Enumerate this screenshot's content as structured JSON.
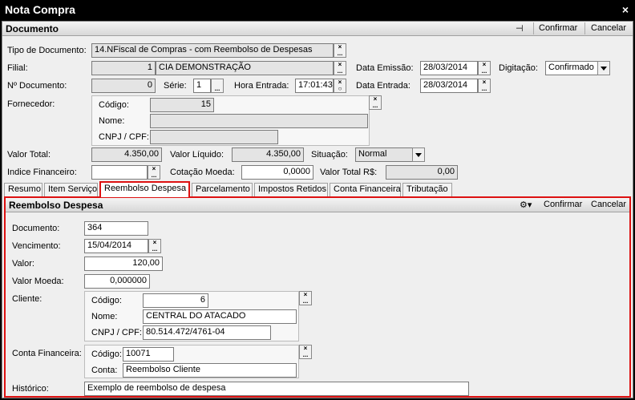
{
  "window": {
    "title": "Nota Compra",
    "close_icon": "×"
  },
  "header": {
    "label": "Documento",
    "pin_icon": "⊣",
    "confirm": "Confirmar",
    "cancel": "Cancelar"
  },
  "form": {
    "tipo_doc_label": "Tipo de Documento:",
    "tipo_doc_value": "14.NFiscal de Compras - com Reembolso de Despesas",
    "filial_label": "Filial:",
    "filial_code": "1",
    "filial_name": "CIA DEMONSTRAÇÃO",
    "data_emissao_label": "Data Emissão:",
    "data_emissao_value": "28/03/2014",
    "digitacao_label": "Digitação:",
    "digitacao_value": "Confirmado",
    "num_doc_label": "Nº Documento:",
    "num_doc_value": "0",
    "serie_label": "Série:",
    "serie_value": "1",
    "hora_entrada_label": "Hora Entrada:",
    "hora_entrada_value": "17:01:43",
    "data_entrada_label": "Data Entrada:",
    "data_entrada_value": "28/03/2014",
    "fornecedor_label": "Fornecedor:",
    "forn_codigo_label": "Código:",
    "forn_codigo_value": "15",
    "forn_nome_label": "Nome:",
    "forn_nome_value": "",
    "forn_cnpj_label": "CNPJ / CPF:",
    "forn_cnpj_value": "",
    "valor_total_label": "Valor Total:",
    "valor_total_value": "4.350,00",
    "valor_liquido_label": "Valor Líquido:",
    "valor_liquido_value": "4.350,00",
    "situacao_label": "Situação:",
    "situacao_value": "Normal",
    "indice_fin_label": "Indice Financeiro:",
    "indice_fin_value": "",
    "cotacao_label": "Cotação Moeda:",
    "cotacao_value": "0,0000",
    "valor_total_rs_label": "Valor Total R$:",
    "valor_total_rs_value": "0,00"
  },
  "tabs": [
    "Resumo",
    "Item Serviço",
    "Reembolso Despesa",
    "Parcelamento",
    "Impostos Retidos",
    "Conta Financeira",
    "Tributação"
  ],
  "panel": {
    "label": "Reembolso Despesa",
    "tools_icon": "⚙▾",
    "confirm": "Confirmar",
    "cancel": "Cancelar",
    "documento_label": "Documento:",
    "documento_value": "364",
    "vencimento_label": "Vencimento:",
    "vencimento_value": "15/04/2014",
    "valor_label": "Valor:",
    "valor_value": "120,00",
    "valor_moeda_label": "Valor Moeda:",
    "valor_moeda_value": "0,000000",
    "cliente_label": "Cliente:",
    "cli_codigo_label": "Código:",
    "cli_codigo_value": "6",
    "cli_nome_label": "Nome:",
    "cli_nome_value": "CENTRAL DO ATACADO",
    "cli_cnpj_label": "CNPJ / CPF:",
    "cli_cnpj_value": "80.514.472/4761-04",
    "conta_fin_label": "Conta Financeira:",
    "cf_codigo_label": "Código:",
    "cf_codigo_value": "10071",
    "cf_conta_label": "Conta:",
    "cf_conta_value": "Reembolso Cliente",
    "historico_label": "Histórico:",
    "historico_value": "Exemplo de reembolso de despesa"
  },
  "picker_icon": {
    "top": "×",
    "bottom": "..."
  }
}
